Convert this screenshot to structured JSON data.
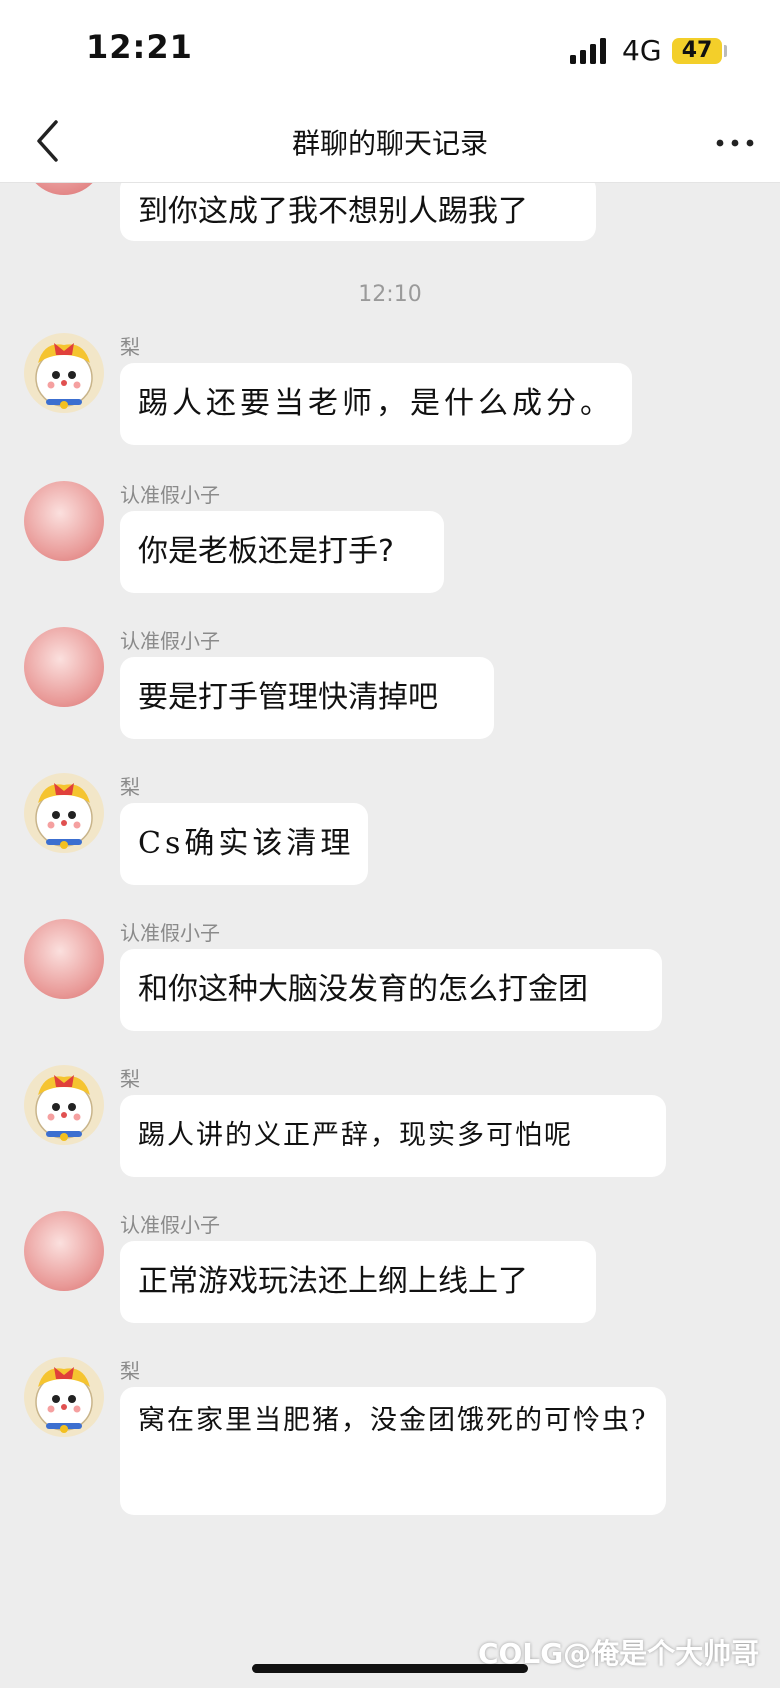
{
  "status_bar": {
    "time": "12:21",
    "network": "4G",
    "battery": "47"
  },
  "header": {
    "title": "群聊的聊天记录"
  },
  "watermark": "COLG@俺是个大帅哥",
  "messages": [
    {
      "kind": "cut",
      "text": "到你这成了我不想别人踢我了"
    },
    {
      "kind": "time",
      "text": "12:10"
    },
    {
      "sender": "梨",
      "avatar": "cartoon-cat-avatar",
      "text": "踢人还要当老师，是什么成分。"
    },
    {
      "sender": "认准假小子",
      "avatar": "pink-avatar",
      "text": "你是老板还是打手?"
    },
    {
      "sender": "认准假小子",
      "avatar": "pink-avatar",
      "text": "要是打手管理快清掉吧"
    },
    {
      "sender": "梨",
      "avatar": "cartoon-cat-avatar",
      "text": "Cs确实该清理"
    },
    {
      "sender": "认准假小子",
      "avatar": "pink-avatar",
      "text": "和你这种大脑没发育的怎么打金团"
    },
    {
      "sender": "梨",
      "avatar": "cartoon-cat-avatar",
      "text": "踢人讲的义正严辞，现实多可怕呢"
    },
    {
      "sender": "认准假小子",
      "avatar": "pink-avatar",
      "text": "正常游戏玩法还上纲上线上了"
    },
    {
      "sender": "梨",
      "avatar": "cartoon-cat-avatar",
      "text": "窝在家里当肥猪，没金团饿死的可怜虫?"
    }
  ]
}
